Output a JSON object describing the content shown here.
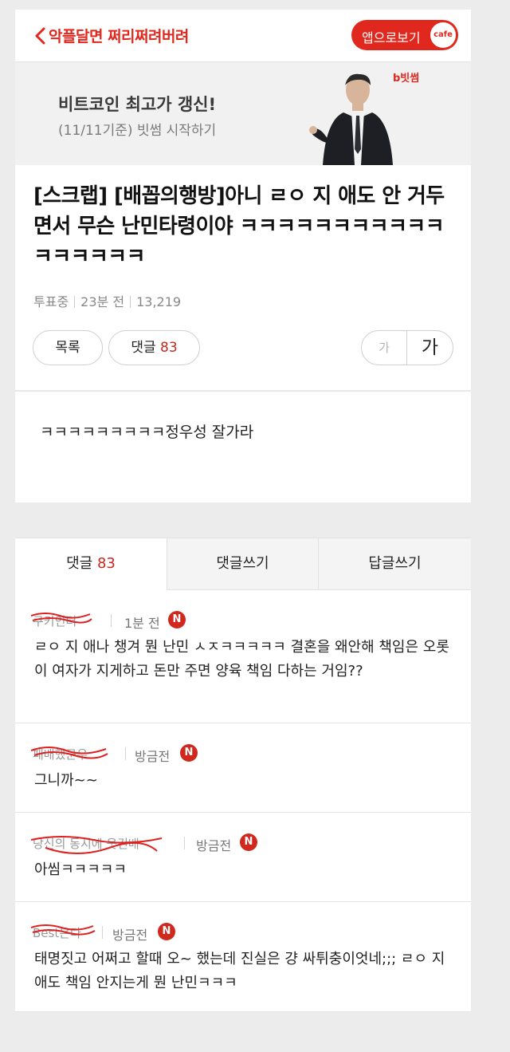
{
  "header": {
    "cafe_name": "악플달면 쩌리쩌려버려",
    "app_button_label": "앱으로보기",
    "cafe_badge": "cafe"
  },
  "ad": {
    "title": "비트코인 최고가 갱신!",
    "subtitle": "(11/11기준) 빗썸 시작하기",
    "brand": "b빗썸"
  },
  "post": {
    "title": "[스크랩] [배꼽의행방]아니 ㄹㅇ 지 애도 안 거두면서 무슨 난민타령이야 ㅋㅋㅋㅋㅋㅋㅋㅋㅋㅋㅋㅋㅋㅋㅋㅋㅋ",
    "status": "투표중",
    "time": "23분 전",
    "views": "13,219",
    "list_label": "목록",
    "comment_label": "댓글",
    "comment_count": "83",
    "font_small": "가",
    "font_large": "가",
    "body": "ㅋㅋㅋㅋㅋㅋㅋㅋㅋ정우성 잘가라"
  },
  "tabs": {
    "comments_label": "댓글",
    "comments_count": "83",
    "write_label": "댓글쓰기",
    "reply_label": "답글쓰기"
  },
  "comments": [
    {
      "author": "쿠키인터",
      "time": "1분 전",
      "badge": "N",
      "text": "ㄹㅇ 지 애나 챙겨 뭔 난민 ㅅㅈㅋㅋㅋㅋㅋ 결혼을 왜안해 책임은 오롯이 여자가 지게하고 돈만 주면 양육 책임 다하는 거임??"
    },
    {
      "author": "패배했군우",
      "time": "방금전",
      "badge": "N",
      "text": "그니까~~"
    },
    {
      "author": "당신의 동시에 웃긴배",
      "time": "방금전",
      "badge": "N",
      "text": "아씸ㅋㅋㅋㅋㅋ"
    },
    {
      "author": "Best온다",
      "time": "방금전",
      "badge": "N",
      "text": "태명짓고 어쩌고 할때 오~ 했는데 진실은 걍 싸튀충이엇네;;; ㄹㅇ 지 애도 책임 안지는게 뭔 난민ㅋㅋㅋ"
    }
  ]
}
